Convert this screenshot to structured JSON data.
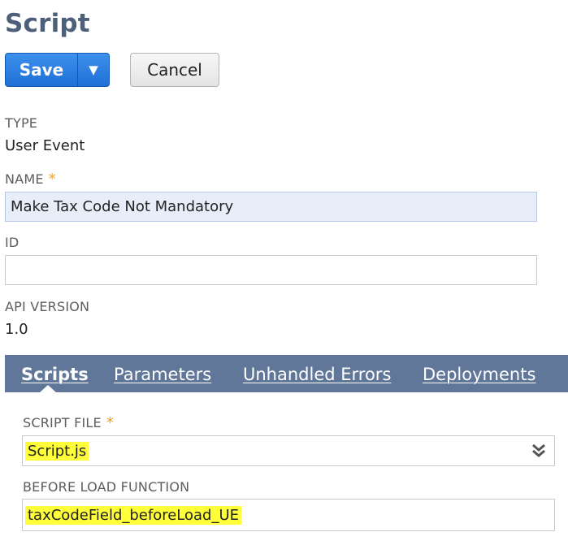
{
  "page": {
    "title": "Script"
  },
  "toolbar": {
    "save_label": "Save",
    "save_menu_glyph": "▼",
    "cancel_label": "Cancel"
  },
  "fields": {
    "type": {
      "label": "TYPE",
      "value": "User Event"
    },
    "name": {
      "label": "NAME",
      "required_mark": "*",
      "value": "Make Tax Code Not Mandatory"
    },
    "id": {
      "label": "ID",
      "value": ""
    },
    "api_version": {
      "label": "API VERSION",
      "value": "1.0"
    }
  },
  "tabs": [
    {
      "label": "Scripts",
      "active": true
    },
    {
      "label": "Parameters",
      "active": false
    },
    {
      "label": "Unhandled Errors",
      "active": false
    },
    {
      "label": "Deployments",
      "active": false
    }
  ],
  "scripts_tab": {
    "script_file": {
      "label": "SCRIPT FILE",
      "required_mark": "*",
      "value": "Script.js"
    },
    "before_load_function": {
      "label": "BEFORE LOAD FUNCTION",
      "value": "taxCodeField_beforeLoad_UE"
    }
  },
  "colors": {
    "title": "#4d5f79",
    "primary_button": "#2a7be0",
    "tabbar": "#607799",
    "required": "#e9a425",
    "highlight": "#ffff3a"
  },
  "icons": {
    "dropdown": "double-chevron-down-icon",
    "save_menu": "triangle-down-icon"
  }
}
